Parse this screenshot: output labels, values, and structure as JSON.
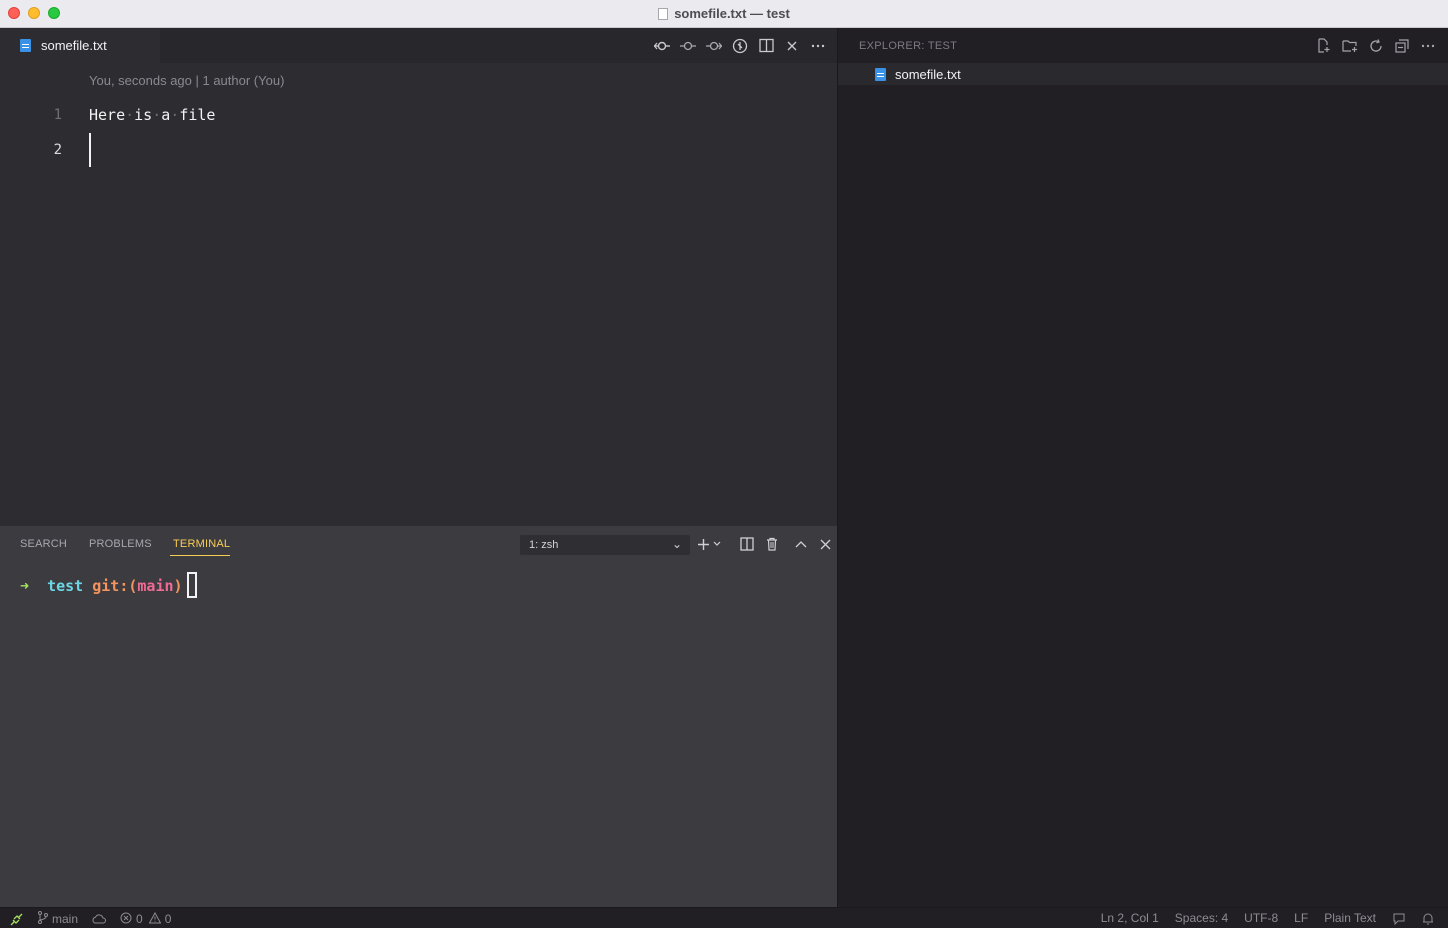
{
  "window": {
    "title": "somefile.txt — test"
  },
  "editor": {
    "tab_label": "somefile.txt",
    "blame": "You, seconds ago | 1 author (You)",
    "lines": [
      {
        "number": "1",
        "text": "Here is a file"
      },
      {
        "number": "2",
        "text": ""
      }
    ],
    "actions": [
      "git-commit-icon",
      "previous-change-icon",
      "next-change-icon",
      "open-changes-icon",
      "split-editor-icon",
      "close-icon",
      "more-icon"
    ]
  },
  "panel": {
    "tabs": [
      {
        "label": "SEARCH"
      },
      {
        "label": "PROBLEMS"
      },
      {
        "label": "TERMINAL"
      }
    ],
    "active_tab": "TERMINAL",
    "terminal_select": "1: zsh",
    "terminal": {
      "arrow": "➜",
      "dir": "test",
      "git": "git:(",
      "branch": "main",
      "git_close": ")"
    }
  },
  "explorer": {
    "title": "EXPLORER: TEST",
    "files": [
      {
        "name": "somefile.txt"
      }
    ]
  },
  "status": {
    "branch": "main",
    "errors": "0",
    "warnings": "0",
    "position": "Ln 2, Col 1",
    "spaces": "Spaces: 4",
    "encoding": "UTF-8",
    "eol": "LF",
    "language": "Plain Text"
  },
  "colors": {
    "accent": "#f7ce55",
    "terminal_dir": "#6dd6e5",
    "terminal_branch": "#f06a95",
    "terminal_arrow": "#a4e25f"
  }
}
